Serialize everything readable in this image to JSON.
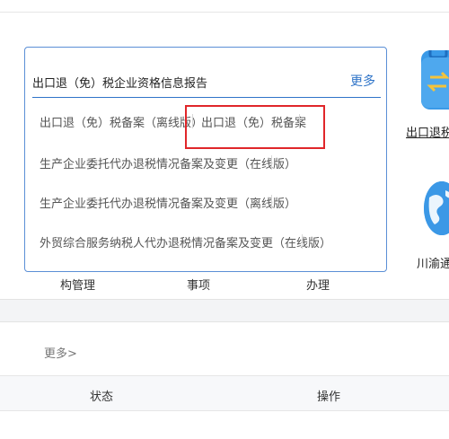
{
  "card": {
    "title": "出口退（免）税企业资格信息报告",
    "more_label": "更多",
    "items": [
      "出口退（免）税备案（离线版）",
      "出口退（免）税备案",
      "生产企业委托代办退税情况备案及变更（在线版）",
      "生产企业委托代办退税情况备案及变更（离线版）",
      "外贸综合服务纳税人代办退税情况备案及变更（在线版）"
    ]
  },
  "apps": [
    {
      "label": "出口退税",
      "icon": "suitcase-exchange-icon",
      "color": "#3a9ae8"
    },
    {
      "label": "川渝通",
      "icon": "globe-icon",
      "color": "#2f8fe0"
    }
  ],
  "tabs": [
    "构管理",
    "事项",
    "办理"
  ],
  "list": {
    "more_label": "更多>",
    "columns": [
      "状态",
      "操作"
    ]
  },
  "colors": {
    "accent": "#2f74c8",
    "highlight": "#e0262a"
  }
}
